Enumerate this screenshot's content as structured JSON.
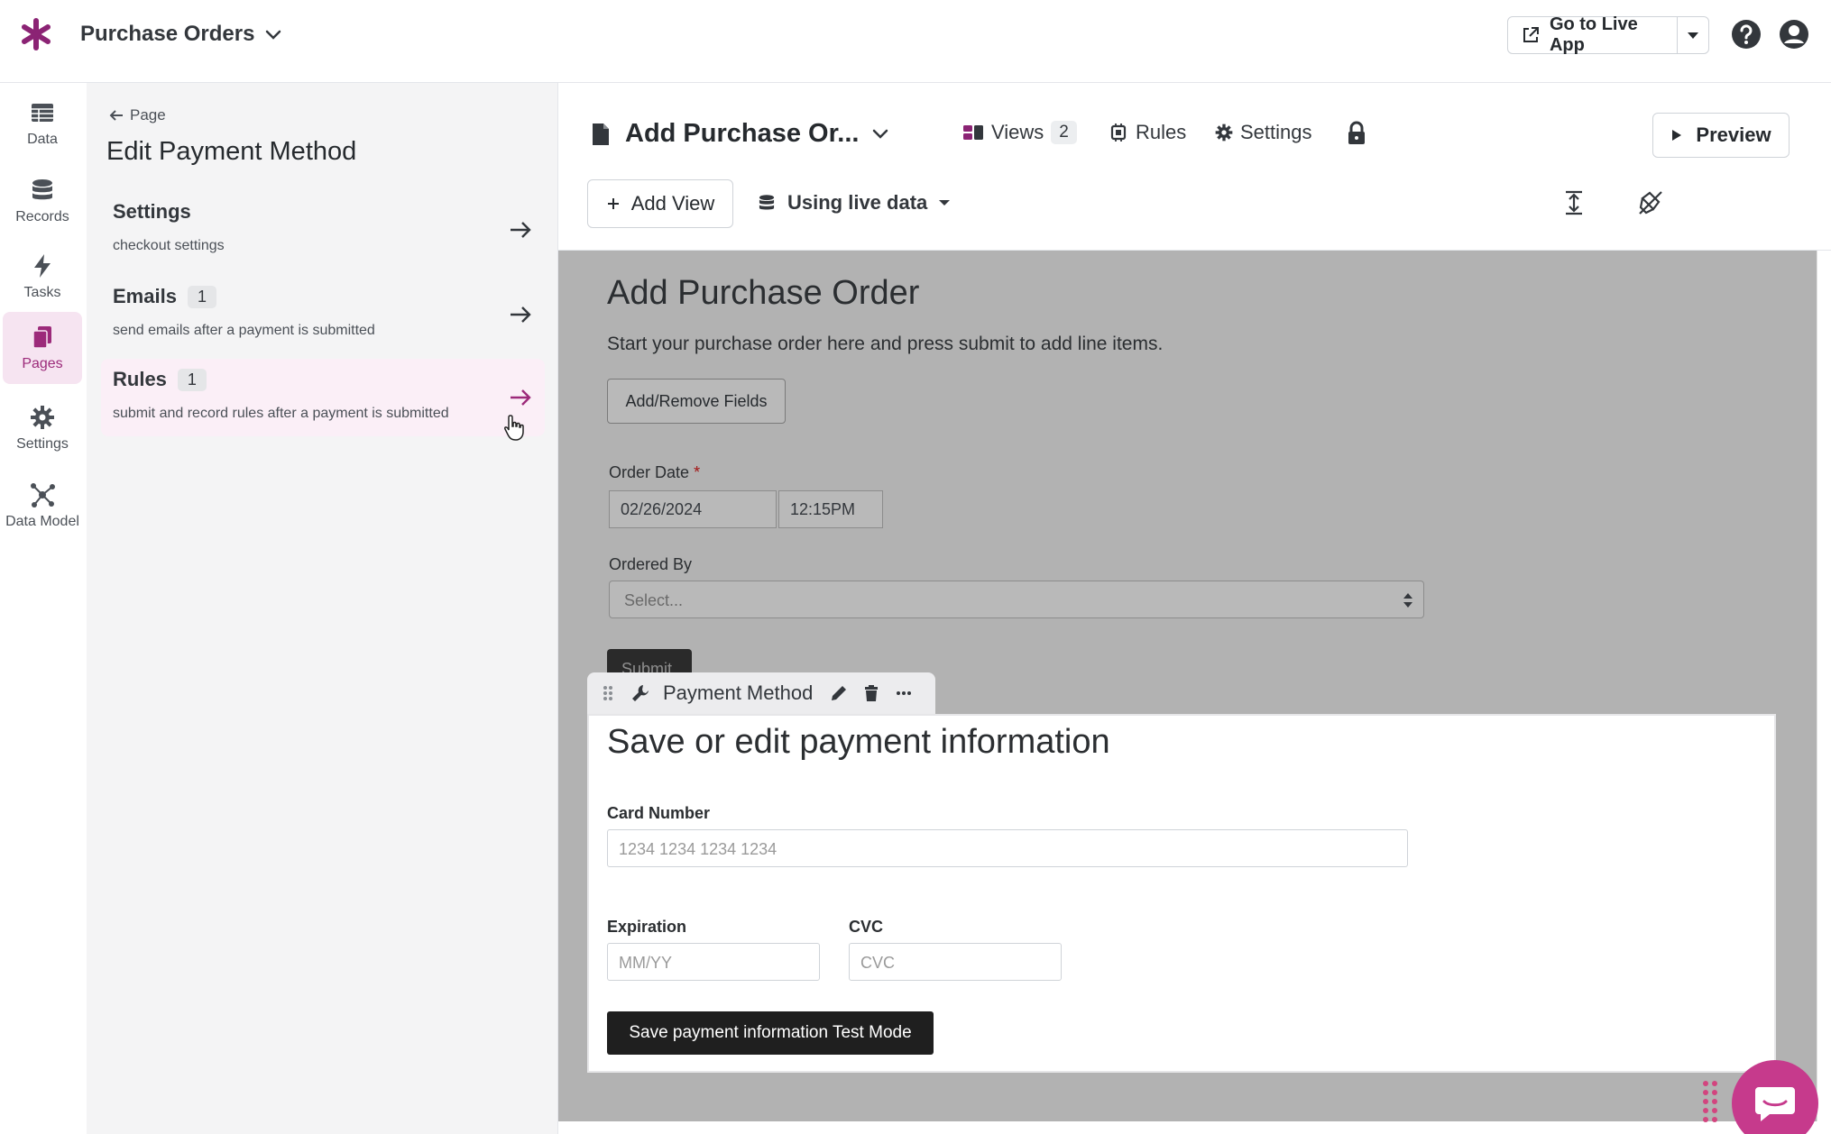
{
  "topbar": {
    "app_title": "Purchase Orders",
    "live_app_label": "Go to Live App",
    "icons": [
      "asterisk-logo-icon",
      "chevron-down-icon",
      "external-link-icon",
      "caret-down-icon",
      "help-icon",
      "account-icon"
    ]
  },
  "nav": {
    "items": [
      {
        "label": "Data",
        "icon": "table-icon"
      },
      {
        "label": "Records",
        "icon": "database-icon"
      },
      {
        "label": "Tasks",
        "icon": "bolt-icon"
      },
      {
        "label": "Pages",
        "icon": "pages-icon",
        "active": true
      },
      {
        "label": "Settings",
        "icon": "gear-icon"
      },
      {
        "label": "Data Model",
        "icon": "network-icon"
      }
    ]
  },
  "panel": {
    "back_label": "Page",
    "title": "Edit Payment Method",
    "rows": [
      {
        "title": "Settings",
        "badge": "",
        "subtitle": "checkout settings"
      },
      {
        "title": "Emails",
        "badge": "1",
        "subtitle": "send emails after a payment is submitted"
      },
      {
        "title": "Rules",
        "badge": "1",
        "subtitle": "submit and record rules after a payment is submitted",
        "active": true
      }
    ]
  },
  "header": {
    "page_name": "Add Purchase Or...",
    "views_label": "Views",
    "views_count": "2",
    "rules_label": "Rules",
    "settings_label": "Settings",
    "preview_label": "Preview",
    "add_view_label": "Add View",
    "live_data_label": "Using live data"
  },
  "form": {
    "heading": "Add Purchase Order",
    "description": "Start your purchase order here and press submit to add line items.",
    "add_fields_label": "Add/Remove Fields",
    "order_date_label": "Order Date",
    "required_mark": "*",
    "date_value": "02/26/2024",
    "time_value": "12:15PM",
    "ordered_by_label": "Ordered By",
    "ordered_by_placeholder": "Select...",
    "submit_label": "Submit"
  },
  "payment": {
    "component_name": "Payment Method",
    "heading": "Save or edit payment information",
    "card_number_label": "Card Number",
    "card_number_placeholder": "1234 1234 1234 1234",
    "expiration_label": "Expiration",
    "expiration_placeholder": "MM/YY",
    "cvc_label": "CVC",
    "cvc_placeholder": "CVC",
    "save_label": "Save payment information Test Mode"
  },
  "colors": {
    "accent": "#9c2a7a",
    "active_nav_bg": "#f6e4f1",
    "active_row_bg": "#fbeff7",
    "canvas_bg": "#b2b2b2",
    "chat": "#c63a8c"
  }
}
